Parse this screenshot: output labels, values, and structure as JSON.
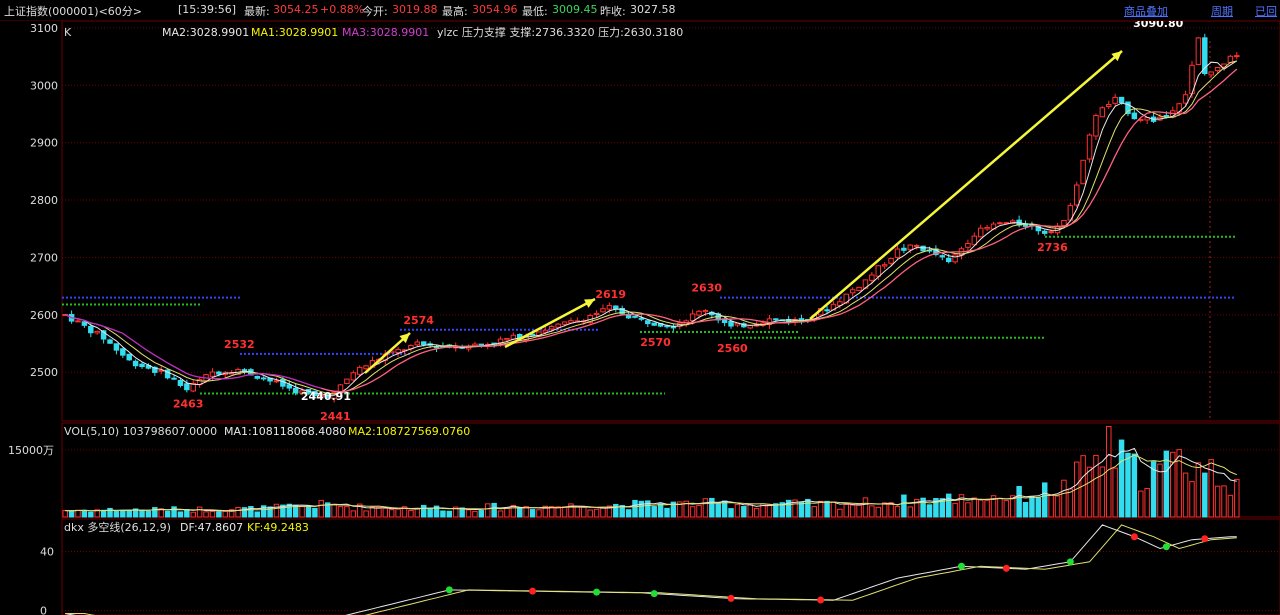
{
  "header": {
    "symbol": "上证指数(000001)<60分>",
    "time": "[15:39:56]",
    "latest_label": "最新:",
    "latest": "3054.25",
    "change": "+0.88%",
    "open_label": "今开:",
    "open": "3019.88",
    "high_label": "最高:",
    "high": "3054.96",
    "low_label": "最低:",
    "low": "3009.45",
    "prev_label": "昨收:",
    "prev": "3027.58",
    "overlay_link": "商品叠加",
    "period_link": "周期",
    "extra_link": "已回"
  },
  "main_panel": {
    "k_label": "K",
    "ma2": "MA2:3028.9901",
    "ma1": "MA1:3028.9901",
    "ma3": "MA3:3028.9901",
    "ylzc": "ylzc 压力支撑 支撑:2736.3320 压力:2630.3180",
    "y_ticks": [
      "3100",
      "3000",
      "2900",
      "2800",
      "2700",
      "2600",
      "2500"
    ],
    "ylim": [
      2415,
      3112
    ],
    "annotations": [
      {
        "text": "2463",
        "x": 19,
        "price": 2463,
        "color": "#ff3030"
      },
      {
        "text": "2532",
        "x": 27,
        "price": 2532,
        "color": "#ff3030"
      },
      {
        "text": "2440.91",
        "x": 39,
        "price": 2440.91,
        "color": "#ffffff"
      },
      {
        "text": "2441",
        "x": 42,
        "price": 2441,
        "color": "#ff3030"
      },
      {
        "text": "2574",
        "x": 55,
        "price": 2574,
        "color": "#ff3030"
      },
      {
        "text": "2619",
        "x": 85,
        "price": 2619,
        "color": "#ff3030"
      },
      {
        "text": "2570",
        "x": 92,
        "price": 2570,
        "color": "#ff3030"
      },
      {
        "text": "2630",
        "x": 100,
        "price": 2630,
        "color": "#ff3030"
      },
      {
        "text": "2560",
        "x": 104,
        "price": 2560,
        "color": "#ff3030"
      },
      {
        "text": "2736",
        "x": 154,
        "price": 2736,
        "color": "#ff3030"
      },
      {
        "text": "3090.80",
        "x": 169,
        "price": 3090.8,
        "color": "#ffffff"
      }
    ]
  },
  "vol_panel": {
    "label": "VOL(5,10) 103798607.0000",
    "ma1": "MA1:108118068.4080",
    "ma2": "MA2:108727569.0760",
    "y_tick": "15000万",
    "ylim": [
      0,
      2.1
    ]
  },
  "dkx_panel": {
    "label": "dkx 多空线(26,12,9)",
    "df": "DF:47.8607",
    "kf": "KF:49.2483",
    "y_ticks": [
      "40",
      "0"
    ],
    "ylim": [
      -3,
      62
    ]
  },
  "colors": {
    "up": "#ff3030",
    "down": "#33ddee",
    "ma_white": "#e8e8e8",
    "ma_yellow": "#e0e070",
    "ma_magenta": "#c030c0",
    "ma_pink": "#ff6080",
    "support_blue": "#3344ff",
    "support_green": "#22bb22",
    "arrow": "#f5f53a",
    "grid": "#6a0000"
  },
  "chart_data": {
    "type": "candlestick",
    "anchors": [
      [
        0,
        2600
      ],
      [
        6,
        2560
      ],
      [
        10,
        2520
      ],
      [
        16,
        2495
      ],
      [
        19,
        2470
      ],
      [
        23,
        2500
      ],
      [
        27,
        2505
      ],
      [
        31,
        2490
      ],
      [
        35,
        2472
      ],
      [
        39,
        2458
      ],
      [
        42,
        2462
      ],
      [
        45,
        2500
      ],
      [
        50,
        2530
      ],
      [
        55,
        2548
      ],
      [
        60,
        2545
      ],
      [
        65,
        2548
      ],
      [
        70,
        2560
      ],
      [
        75,
        2575
      ],
      [
        80,
        2590
      ],
      [
        85,
        2612
      ],
      [
        90,
        2590
      ],
      [
        95,
        2582
      ],
      [
        100,
        2610
      ],
      [
        104,
        2578
      ],
      [
        110,
        2592
      ],
      [
        115,
        2590
      ],
      [
        120,
        2618
      ],
      [
        125,
        2660
      ],
      [
        130,
        2712
      ],
      [
        133,
        2720
      ],
      [
        136,
        2705
      ],
      [
        138,
        2690
      ],
      [
        142,
        2742
      ],
      [
        146,
        2760
      ],
      [
        150,
        2758
      ],
      [
        153,
        2745
      ],
      [
        156,
        2760
      ],
      [
        158,
        2830
      ],
      [
        161,
        2950
      ],
      [
        164,
        2975
      ],
      [
        167,
        2945
      ],
      [
        170,
        2940
      ],
      [
        172,
        2948
      ],
      [
        175,
        2985
      ],
      [
        177,
        3080
      ],
      [
        178,
        3020
      ],
      [
        180,
        3028
      ],
      [
        182,
        3054
      ]
    ],
    "volume_anchors": [
      [
        0,
        0.15
      ],
      [
        30,
        0.18
      ],
      [
        41,
        0.28
      ],
      [
        45,
        0.22
      ],
      [
        60,
        0.2
      ],
      [
        80,
        0.25
      ],
      [
        100,
        0.3
      ],
      [
        120,
        0.28
      ],
      [
        140,
        0.42
      ],
      [
        150,
        0.5
      ],
      [
        156,
        0.65
      ],
      [
        160,
        1.15
      ],
      [
        163,
        1.5
      ],
      [
        168,
        0.95
      ],
      [
        174,
        1.25
      ],
      [
        178,
        1.1
      ],
      [
        182,
        0.8
      ]
    ],
    "dkx_anchors": [
      [
        0,
        -2
      ],
      [
        15,
        -14
      ],
      [
        30,
        -18
      ],
      [
        45,
        -2
      ],
      [
        60,
        14
      ],
      [
        75,
        13
      ],
      [
        90,
        12
      ],
      [
        105,
        8
      ],
      [
        120,
        7
      ],
      [
        130,
        22
      ],
      [
        140,
        30
      ],
      [
        150,
        28
      ],
      [
        157,
        33
      ],
      [
        162,
        58
      ],
      [
        167,
        50
      ],
      [
        171,
        42
      ],
      [
        176,
        48
      ],
      [
        182,
        50
      ]
    ]
  }
}
